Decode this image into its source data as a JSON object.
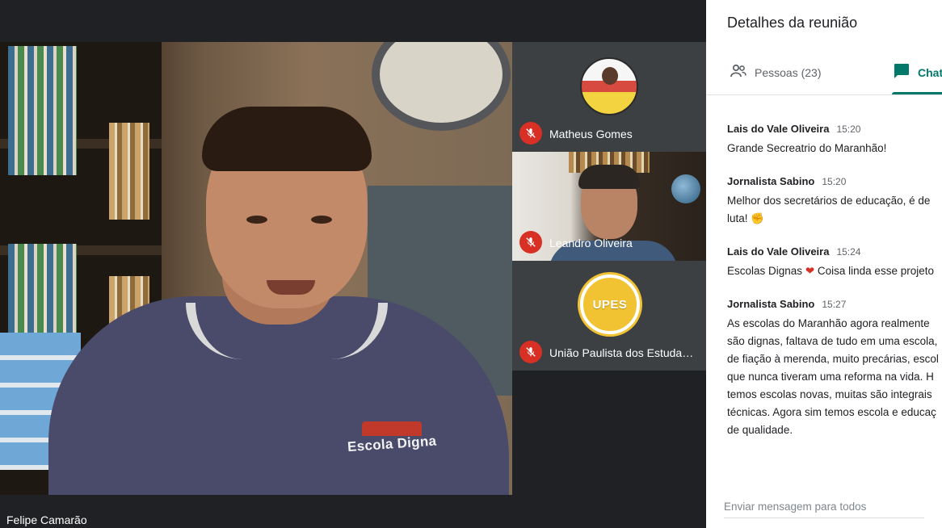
{
  "main_video": {
    "participant_name": "Felipe Camarão",
    "shirt_logo_text": "Escola Digna"
  },
  "tiles": [
    {
      "name": "Matheus Gomes",
      "muted": true,
      "icon": "mic-off-icon"
    },
    {
      "name": "Leandro Oliveira",
      "muted": true,
      "icon": "mic-off-icon"
    },
    {
      "name": "União Paulista dos Estudantes",
      "display_name": "União Paulista dos Estuda…",
      "muted": true,
      "icon": "mic-off-icon",
      "logo_text": "UPES"
    }
  ],
  "panel": {
    "title": "Detalhes da reunião",
    "tabs": [
      {
        "label": "Pessoas (23)",
        "icon": "people-icon",
        "active": false
      },
      {
        "label": "Chat",
        "icon": "chat-icon",
        "active": true
      }
    ],
    "messages": [
      {
        "sender": "Lais do Vale Oliveira",
        "time": "15:20",
        "lines": [
          "Grande Secreatrio do Maranhão!"
        ]
      },
      {
        "sender": "Jornalista Sabino",
        "time": "15:20",
        "lines": [
          "Melhor dos secretários de educação, é de",
          "luta! ✊"
        ]
      },
      {
        "sender": "Lais do Vale Oliveira",
        "time": "15:24",
        "lines": [
          "Escolas Dignas",
          "Coisa linda esse projeto"
        ]
      },
      {
        "sender": "Jornalista Sabino",
        "time": "15:27",
        "lines": [
          "As escolas do Maranhão agora realmente",
          "são dignas, faltava de tudo em uma escola,",
          "de fiação à merenda, muito precárias, escol",
          "que nunca tiveram uma reforma na vida. H",
          "temos escolas novas, muitas são integrais",
          "técnicas. Agora sim temos escola e educaç",
          "de qualidade."
        ]
      }
    ],
    "composer_placeholder": "Enviar mensagem para todos"
  },
  "colors": {
    "accent": "#00796b",
    "muted_red": "#d93025",
    "stage_bg": "#202124",
    "panel_bg": "#ffffff"
  }
}
